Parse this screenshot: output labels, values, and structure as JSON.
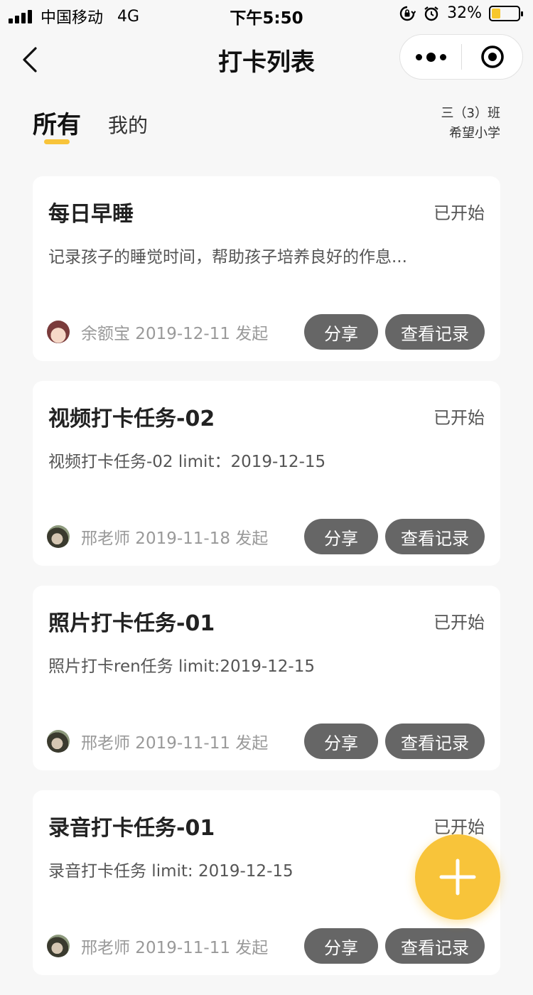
{
  "status_bar": {
    "carrier": "中国移动",
    "network": "4G",
    "time": "下午5:50",
    "battery_percent": "32%",
    "battery_level": 0.32,
    "battery_color": "#f7c72b",
    "icons": [
      "signal-icon",
      "rotation-lock-icon",
      "alarm-icon",
      "battery-icon"
    ]
  },
  "nav": {
    "title": "打卡列表",
    "icons": [
      "back-arrow-icon",
      "more-dots-icon",
      "close-target-icon"
    ]
  },
  "tabs": [
    {
      "label": "所有",
      "active": true
    },
    {
      "label": "我的",
      "active": false
    }
  ],
  "class_info": {
    "class_name": "三（3）班",
    "school_name": "希望小学"
  },
  "accent_color": "#f8c43a",
  "cards": [
    {
      "title": "每日早睡",
      "status": "已开始",
      "description": "记录孩子的睡觉时间，帮助孩子培养良好的作息...",
      "meta": "余额宝 2019-12-11 发起",
      "share_label": "分享",
      "records_label": "查看记录",
      "avatar": "girl-avatar"
    },
    {
      "title": "视频打卡任务-02",
      "status": "已开始",
      "description": "视频打卡任务-02 limit：2019-12-15",
      "meta": "邢老师 2019-11-18 发起",
      "share_label": "分享",
      "records_label": "查看记录",
      "avatar": "teacher-avatar"
    },
    {
      "title": "照片打卡任务-01",
      "status": "已开始",
      "description": "照片打卡ren任务 limit:2019-12-15",
      "meta": "邢老师 2019-11-11 发起",
      "share_label": "分享",
      "records_label": "查看记录",
      "avatar": "teacher-avatar"
    },
    {
      "title": "录音打卡任务-01",
      "status": "已开始",
      "description": "录音打卡任务 limit: 2019-12-15",
      "meta": "邢老师 2019-11-11 发起",
      "share_label": "分享",
      "records_label": "查看记录",
      "avatar": "teacher-avatar"
    }
  ],
  "fab": {
    "icon": "plus-icon"
  }
}
